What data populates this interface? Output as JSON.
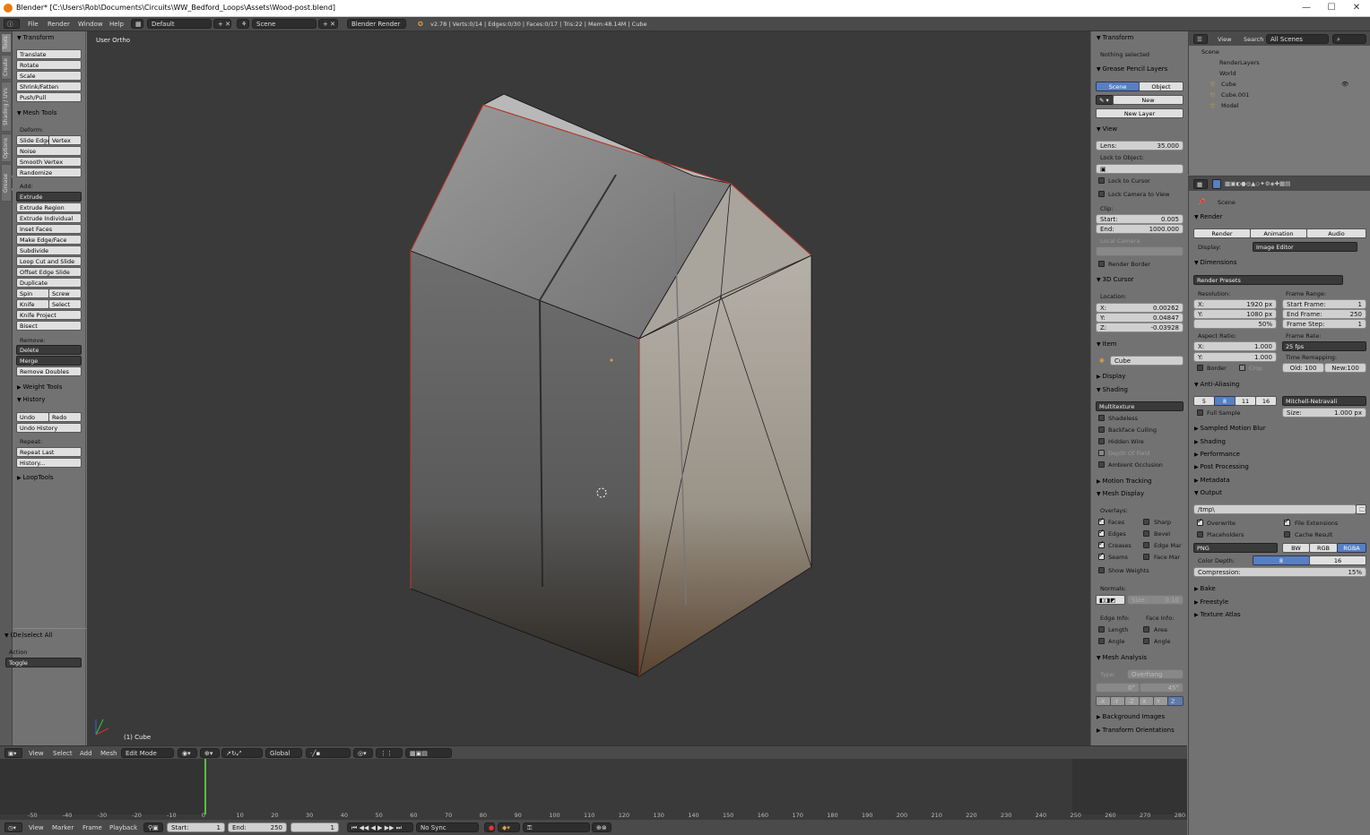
{
  "window": {
    "title": "Blender* [C:\\Users\\Rob\\Documents\\Circuits\\WW_Bedford_Loops\\Assets\\Wood-post.blend]",
    "minimize": "—",
    "maximize": "☐",
    "close": "✕"
  },
  "info_bar": {
    "menus": [
      "File",
      "Render",
      "Window",
      "Help"
    ],
    "layout": "Default",
    "scene": "Scene",
    "engine": "Blender Render",
    "stats": "v2.78 | Verts:0/14 | Edges:0/30 | Faces:0/17 | Tris:22 | Mem:48.14M | Cube"
  },
  "tool_tabs": [
    "Tools",
    "Create",
    "Shading / UVs",
    "Options",
    "Grease Pencil"
  ],
  "tool_shelf": {
    "transform": {
      "header": "Transform",
      "buttons": [
        "Translate",
        "Rotate",
        "Scale",
        "Shrink/Fatten",
        "Push/Pull"
      ]
    },
    "mesh_tools": {
      "header": "Mesh Tools",
      "deform_label": "Deform:",
      "slide_edge": "Slide Edge",
      "vertex": "Vertex",
      "deform": [
        "Noise",
        "Smooth Vertex",
        "Randomize"
      ],
      "add_label": "Add:",
      "extrude": "Extrude",
      "add": [
        "Extrude Region",
        "Extrude Individual",
        "Inset Faces",
        "Make Edge/Face",
        "Subdivide",
        "Loop Cut and Slide",
        "Offset Edge Slide",
        "Duplicate"
      ],
      "spin": "Spin",
      "screw": "Screw",
      "knife": "Knife",
      "select": "Select",
      "knife_project": "Knife Project",
      "bisect": "Bisect",
      "remove_label": "Remove:",
      "delete": "Delete",
      "merge": "Merge",
      "remove_doubles": "Remove Doubles"
    },
    "weight_tools": "Weight Tools",
    "history": {
      "header": "History",
      "undo": "Undo",
      "redo": "Redo",
      "undo_history": "Undo History",
      "repeat_label": "Repeat:",
      "repeat_last": "Repeat Last",
      "history_btn": "History..."
    },
    "looptools": "LoopTools",
    "operator": {
      "header": "(De)select All",
      "action_label": "Action",
      "action_value": "Toggle"
    }
  },
  "viewport": {
    "view_name": "User Ortho",
    "object_label": "(1) Cube"
  },
  "n_panel": {
    "transform": "Transform",
    "nothing_selected": "Nothing selected",
    "grease_pencil": "Grease Pencil Layers",
    "scene_tab": "Scene",
    "object_tab": "Object",
    "new_btn": "New",
    "new_layer": "New Layer",
    "view": "View",
    "lens": "Lens:",
    "lens_value": "35.000",
    "lock_to_object": "Lock to Object:",
    "lock_to_cursor": "Lock to Cursor",
    "lock_camera": "Lock Camera to View",
    "clip": "Clip:",
    "clip_start": "Start:",
    "clip_start_value": "0.005",
    "clip_end": "End:",
    "clip_end_value": "1000.000",
    "local_camera": "Local Camera",
    "render_border": "Render Border",
    "cursor": "3D Cursor",
    "location": "Location:",
    "cx": "X:",
    "cx_v": "0.00262",
    "cy": "Y:",
    "cy_v": "0.04847",
    "cz": "Z:",
    "cz_v": "-0.03928",
    "item": "Item",
    "item_name": "Cube",
    "display": "Display",
    "shading": "Shading",
    "shading_mode": "Multitexture",
    "shading_opts": [
      "Shadeless",
      "Backface Culling",
      "Hidden Wire",
      "Depth Of Field",
      "Ambient Occlusion"
    ],
    "motion_tracking": "Motion Tracking",
    "mesh_display": "Mesh Display",
    "overlays": "Overlays:",
    "ov_left": [
      "Faces",
      "Edges",
      "Creases",
      "Seams"
    ],
    "ov_right": [
      "Sharp",
      "Bevel",
      "Edge Mar",
      "Face Mar"
    ],
    "show_weights": "Show Weights",
    "normals": "Normals:",
    "normal_size": "Size:",
    "normal_size_v": "0.10",
    "edge_info": "Edge Info:",
    "face_info": "Face Info:",
    "length": "Length",
    "area": "Area",
    "angle_e": "Angle",
    "angle_f": "Angle",
    "mesh_analysis": "Mesh Analysis",
    "type_label": "Type:",
    "type_value": "Overhang",
    "range_min": "0°",
    "range_max": "45°",
    "axes": [
      "-X",
      "-Y",
      "-Z",
      "X",
      "Y",
      "Z"
    ],
    "bg_images": "Background Images",
    "transform_orient": "Transform Orientations"
  },
  "outliner": {
    "view": "View",
    "search": "Search",
    "filter": "All Scenes",
    "items": [
      "Scene",
      "RenderLayers",
      "World",
      "Cube",
      "Cube.001",
      "Model"
    ]
  },
  "properties": {
    "scene_label": "Scene",
    "render": "Render",
    "render_btn": "Render",
    "animation_btn": "Animation",
    "audio_btn": "Audio",
    "display_label": "Display:",
    "display_value": "Image Editor",
    "dimensions": "Dimensions",
    "render_presets": "Render Presets",
    "resolution": "Resolution:",
    "res_x": "X:",
    "res_x_v": "1920 px",
    "res_y": "Y:",
    "res_y_v": "1080 px",
    "res_pct": "50%",
    "frame_range": "Frame Range:",
    "start_frame": "Start Frame:",
    "start_frame_v": "1",
    "end_frame": "End Frame:",
    "end_frame_v": "250",
    "frame_step": "Frame Step:",
    "frame_step_v": "1",
    "aspect": "Aspect Ratio:",
    "asp_x": "X:",
    "asp_x_v": "1.000",
    "asp_y": "Y:",
    "asp_y_v": "1.000",
    "frame_rate": "Frame Rate:",
    "fps": "25 fps",
    "time_remap": "Time Remapping:",
    "old": "Old: 100",
    "new": "New:100",
    "border": "Border",
    "crop": "Crop",
    "anti_aliasing": "Anti-Aliasing",
    "aa_samples": [
      "5",
      "8",
      "11",
      "16"
    ],
    "filter": "Mitchell-Netravali",
    "full_sample": "Full Sample",
    "size_label": "Size:",
    "size_v": "1.000 px",
    "sampled_motion_blur": "Sampled Motion Blur",
    "shading": "Shading",
    "performance": "Performance",
    "post_processing": "Post Processing",
    "metadata": "Metadata",
    "output": "Output",
    "output_path": "/tmp\\",
    "overwrite": "Overwrite",
    "file_ext": "File Extensions",
    "placeholders": "Placeholders",
    "cache_result": "Cache Result",
    "format": "PNG",
    "bw": "BW",
    "rgb": "RGB",
    "rgba": "RGBA",
    "color_depth": "Color Depth:",
    "depth8": "8",
    "depth16": "16",
    "compression": "Compression:",
    "compression_v": "15%",
    "bake": "Bake",
    "freestyle": "Freestyle",
    "texture_atlas": "Texture Atlas"
  },
  "view3d_header": {
    "menus": [
      "View",
      "Select",
      "Add",
      "Mesh"
    ],
    "mode": "Edit Mode",
    "orientation": "Global"
  },
  "timeline": {
    "ticks": [
      "-50",
      "-40",
      "-30",
      "-20",
      "-10",
      "0",
      "10",
      "20",
      "30",
      "40",
      "50",
      "60",
      "70",
      "80",
      "90",
      "100",
      "110",
      "120",
      "130",
      "140",
      "150",
      "160",
      "170",
      "180",
      "190",
      "200",
      "210",
      "220",
      "230",
      "240",
      "250",
      "260",
      "270",
      "280"
    ],
    "current_frame": 1,
    "menus": [
      "View",
      "Marker",
      "Frame",
      "Playback"
    ],
    "start": "Start:",
    "start_v": "1",
    "end": "End:",
    "end_v": "250",
    "frame_v": "1",
    "sync": "No Sync"
  },
  "colors": {
    "accent": "#5680c2",
    "edge": "#c0392b",
    "current_frame": "#58c03a"
  }
}
